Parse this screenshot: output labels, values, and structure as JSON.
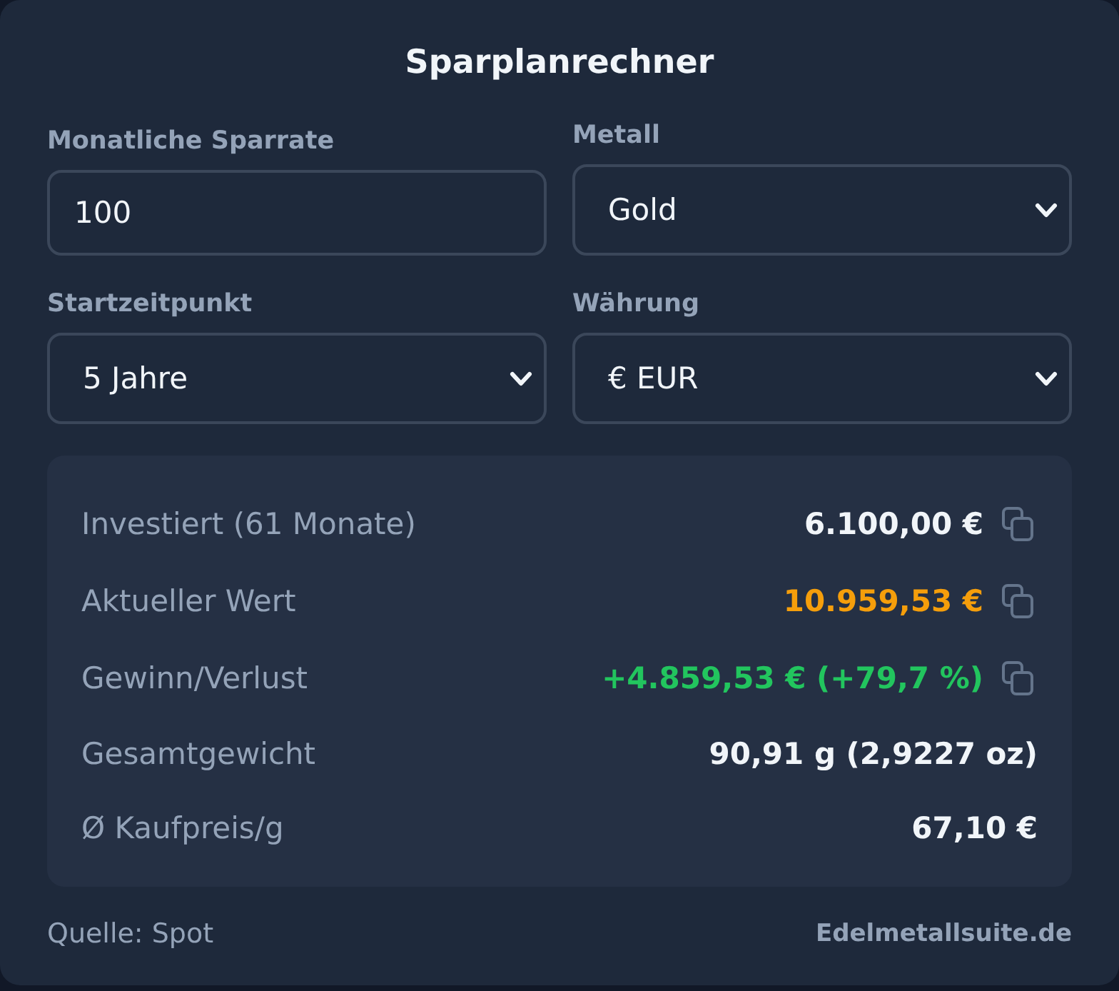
{
  "title": "Sparplanrechner",
  "fields": [
    {
      "label": "Monatliche Sparrate",
      "kind": "input",
      "value": "100"
    },
    {
      "label": "Metall",
      "kind": "select",
      "value": "Gold"
    },
    {
      "label": "Startzeitpunkt",
      "kind": "select",
      "value": "5 Jahre"
    },
    {
      "label": "Währung",
      "kind": "select",
      "value": "€ EUR"
    }
  ],
  "results": [
    {
      "label": "Investiert (61 Monate)",
      "value": "6.100,00 €",
      "color": "#f1f5f9",
      "copyable": true
    },
    {
      "label": "Aktueller Wert",
      "value": "10.959,53 €",
      "color": "#f59e0b",
      "copyable": true
    },
    {
      "label": "Gewinn/Verlust",
      "value": "+4.859,53 € (+79,7 %)",
      "color": "#22c55e",
      "copyable": true
    },
    {
      "label": "Gesamtgewicht",
      "value": "90,91 g (2,9227 oz)",
      "color": "#f1f5f9",
      "copyable": false
    },
    {
      "label": "Ø Kaufpreis/g",
      "value": "67,10 €",
      "color": "#f1f5f9",
      "copyable": false
    }
  ],
  "footer": {
    "source": "Quelle: Spot",
    "brand": "Edelmetallsuite.de"
  }
}
